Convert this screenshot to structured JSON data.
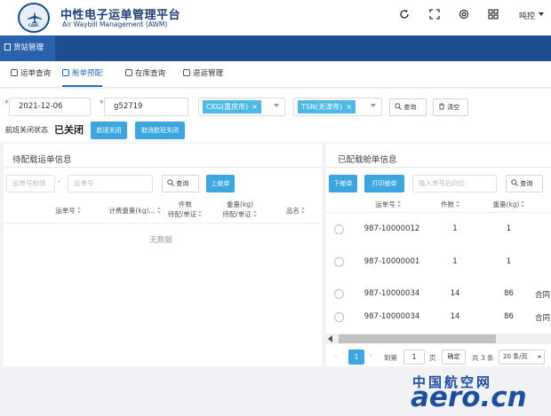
{
  "header": {
    "logo_text": "CAAC",
    "title_cn": "中性电子运单管理平台",
    "title_en": "Air Waybill Management (AWM)",
    "icons": [
      "refresh-icon",
      "fullscreen-icon",
      "support-icon",
      "apps-icon"
    ],
    "user_name": "吨控"
  },
  "nav": {
    "active_tab": "货站管理"
  },
  "subtabs": [
    {
      "label": "运单查询",
      "active": false
    },
    {
      "label": "舱单预配",
      "active": true
    },
    {
      "label": "在库查询",
      "active": false
    },
    {
      "label": "退运管理",
      "active": false
    }
  ],
  "form": {
    "date": "2021-12-06",
    "flight_no": "g52719",
    "origin": "CKG(重庆市)",
    "destination": "TSN(天津市)",
    "query_label": "查询",
    "clear_label": "清空",
    "flight_status_label": "航班关闭状态",
    "flight_status_value": "已关闭",
    "close_flight_label": "航班关闭",
    "cancel_close_label": "取消航班关闭"
  },
  "left_panel": {
    "title": "待配载运单信息",
    "prefix_placeholder": "运单号前缀",
    "dash": "-",
    "number_placeholder": "运单号",
    "query_label": "查询",
    "load_label": "上舱单",
    "columns": [
      {
        "line1": "运单号",
        "line2": ""
      },
      {
        "line1": "计费重量(kg)...",
        "line2": ""
      },
      {
        "line1": "件数",
        "line2": "待配/单证"
      },
      {
        "line1": "重量(kg)",
        "line2": "待配/单证"
      },
      {
        "line1": "品名",
        "line2": ""
      }
    ],
    "empty_text": "无数据"
  },
  "right_panel": {
    "title": "已配载舱单信息",
    "unload_label": "下舱单",
    "print_label": "打印舱单",
    "search_placeholder": "输入单号后四位",
    "query_label": "查询",
    "columns": [
      "运单号",
      "件数",
      "重量(kg)"
    ],
    "rows": [
      {
        "awb": "987-10000012",
        "pieces": "1",
        "weight": "1",
        "extra": ""
      },
      {
        "awb": "987-10000001",
        "pieces": "1",
        "weight": "1",
        "extra": ""
      },
      {
        "awb": "987-10000034",
        "pieces": "14",
        "weight": "86",
        "extra": "合同"
      },
      {
        "awb": "987-10000034",
        "pieces": "14",
        "weight": "86",
        "extra": "合同"
      }
    ],
    "pager": {
      "prev": "‹",
      "current": "1",
      "next": "›",
      "goto_label": "到第",
      "goto_value": "1",
      "page_unit": "页",
      "confirm": "确定",
      "total": "共 3 条",
      "page_size": "20 条/页"
    }
  },
  "watermark": {
    "cn": "中国航空网",
    "en": "aero.cn"
  }
}
